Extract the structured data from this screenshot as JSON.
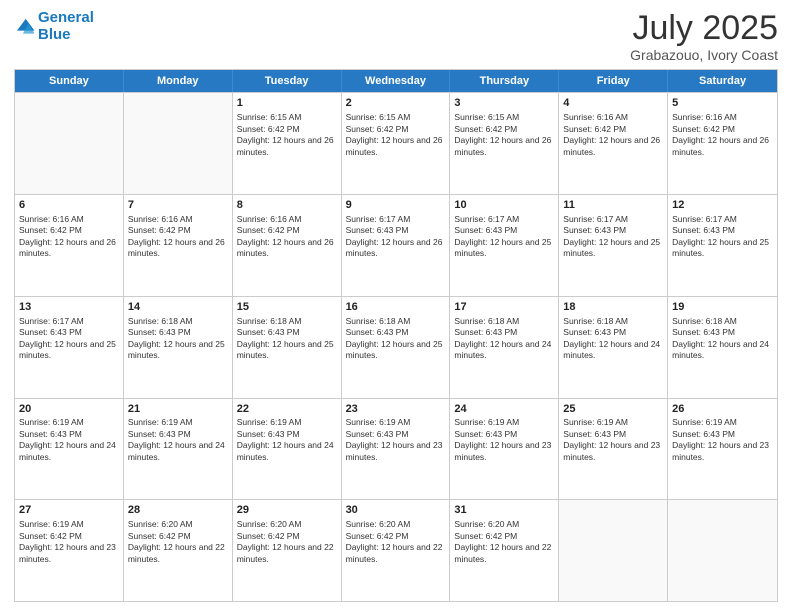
{
  "header": {
    "logo_line1": "General",
    "logo_line2": "Blue",
    "month": "July 2025",
    "location": "Grabazouo, Ivory Coast"
  },
  "days": [
    "Sunday",
    "Monday",
    "Tuesday",
    "Wednesday",
    "Thursday",
    "Friday",
    "Saturday"
  ],
  "weeks": [
    [
      {
        "day": "",
        "text": ""
      },
      {
        "day": "",
        "text": ""
      },
      {
        "day": "1",
        "text": "Sunrise: 6:15 AM\nSunset: 6:42 PM\nDaylight: 12 hours and 26 minutes."
      },
      {
        "day": "2",
        "text": "Sunrise: 6:15 AM\nSunset: 6:42 PM\nDaylight: 12 hours and 26 minutes."
      },
      {
        "day": "3",
        "text": "Sunrise: 6:15 AM\nSunset: 6:42 PM\nDaylight: 12 hours and 26 minutes."
      },
      {
        "day": "4",
        "text": "Sunrise: 6:16 AM\nSunset: 6:42 PM\nDaylight: 12 hours and 26 minutes."
      },
      {
        "day": "5",
        "text": "Sunrise: 6:16 AM\nSunset: 6:42 PM\nDaylight: 12 hours and 26 minutes."
      }
    ],
    [
      {
        "day": "6",
        "text": "Sunrise: 6:16 AM\nSunset: 6:42 PM\nDaylight: 12 hours and 26 minutes."
      },
      {
        "day": "7",
        "text": "Sunrise: 6:16 AM\nSunset: 6:42 PM\nDaylight: 12 hours and 26 minutes."
      },
      {
        "day": "8",
        "text": "Sunrise: 6:16 AM\nSunset: 6:42 PM\nDaylight: 12 hours and 26 minutes."
      },
      {
        "day": "9",
        "text": "Sunrise: 6:17 AM\nSunset: 6:43 PM\nDaylight: 12 hours and 26 minutes."
      },
      {
        "day": "10",
        "text": "Sunrise: 6:17 AM\nSunset: 6:43 PM\nDaylight: 12 hours and 25 minutes."
      },
      {
        "day": "11",
        "text": "Sunrise: 6:17 AM\nSunset: 6:43 PM\nDaylight: 12 hours and 25 minutes."
      },
      {
        "day": "12",
        "text": "Sunrise: 6:17 AM\nSunset: 6:43 PM\nDaylight: 12 hours and 25 minutes."
      }
    ],
    [
      {
        "day": "13",
        "text": "Sunrise: 6:17 AM\nSunset: 6:43 PM\nDaylight: 12 hours and 25 minutes."
      },
      {
        "day": "14",
        "text": "Sunrise: 6:18 AM\nSunset: 6:43 PM\nDaylight: 12 hours and 25 minutes."
      },
      {
        "day": "15",
        "text": "Sunrise: 6:18 AM\nSunset: 6:43 PM\nDaylight: 12 hours and 25 minutes."
      },
      {
        "day": "16",
        "text": "Sunrise: 6:18 AM\nSunset: 6:43 PM\nDaylight: 12 hours and 25 minutes."
      },
      {
        "day": "17",
        "text": "Sunrise: 6:18 AM\nSunset: 6:43 PM\nDaylight: 12 hours and 24 minutes."
      },
      {
        "day": "18",
        "text": "Sunrise: 6:18 AM\nSunset: 6:43 PM\nDaylight: 12 hours and 24 minutes."
      },
      {
        "day": "19",
        "text": "Sunrise: 6:18 AM\nSunset: 6:43 PM\nDaylight: 12 hours and 24 minutes."
      }
    ],
    [
      {
        "day": "20",
        "text": "Sunrise: 6:19 AM\nSunset: 6:43 PM\nDaylight: 12 hours and 24 minutes."
      },
      {
        "day": "21",
        "text": "Sunrise: 6:19 AM\nSunset: 6:43 PM\nDaylight: 12 hours and 24 minutes."
      },
      {
        "day": "22",
        "text": "Sunrise: 6:19 AM\nSunset: 6:43 PM\nDaylight: 12 hours and 24 minutes."
      },
      {
        "day": "23",
        "text": "Sunrise: 6:19 AM\nSunset: 6:43 PM\nDaylight: 12 hours and 23 minutes."
      },
      {
        "day": "24",
        "text": "Sunrise: 6:19 AM\nSunset: 6:43 PM\nDaylight: 12 hours and 23 minutes."
      },
      {
        "day": "25",
        "text": "Sunrise: 6:19 AM\nSunset: 6:43 PM\nDaylight: 12 hours and 23 minutes."
      },
      {
        "day": "26",
        "text": "Sunrise: 6:19 AM\nSunset: 6:43 PM\nDaylight: 12 hours and 23 minutes."
      }
    ],
    [
      {
        "day": "27",
        "text": "Sunrise: 6:19 AM\nSunset: 6:42 PM\nDaylight: 12 hours and 23 minutes."
      },
      {
        "day": "28",
        "text": "Sunrise: 6:20 AM\nSunset: 6:42 PM\nDaylight: 12 hours and 22 minutes."
      },
      {
        "day": "29",
        "text": "Sunrise: 6:20 AM\nSunset: 6:42 PM\nDaylight: 12 hours and 22 minutes."
      },
      {
        "day": "30",
        "text": "Sunrise: 6:20 AM\nSunset: 6:42 PM\nDaylight: 12 hours and 22 minutes."
      },
      {
        "day": "31",
        "text": "Sunrise: 6:20 AM\nSunset: 6:42 PM\nDaylight: 12 hours and 22 minutes."
      },
      {
        "day": "",
        "text": ""
      },
      {
        "day": "",
        "text": ""
      }
    ]
  ]
}
